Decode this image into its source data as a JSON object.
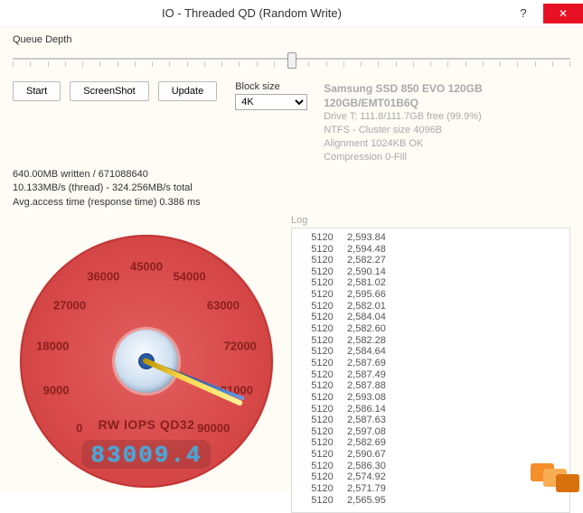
{
  "window": {
    "title": "IO - Threaded QD (Random Write)",
    "help_glyph": "?",
    "close_glyph": "✕"
  },
  "queue_depth": {
    "label": "Queue Depth"
  },
  "buttons": {
    "start": "Start",
    "screenshot": "ScreenShot",
    "update": "Update"
  },
  "block_size": {
    "label": "Block size",
    "value": "4K"
  },
  "drive": {
    "name": "Samsung SSD 850 EVO 120GB 120GB/EMT01B6Q",
    "line1": "Drive T: 111.8/111.7GB free (99.9%)",
    "line2": "NTFS - Cluster size 4096B",
    "line3": "Alignment 1024KB OK",
    "line4": "Compression 0-Fill"
  },
  "stats": {
    "line1": "640.00MB written / 671088640",
    "line2": "10.133MB/s (thread) - 324.256MB/s total",
    "line3": "Avg.access time (response time) 0.386 ms"
  },
  "log": {
    "label": "Log",
    "rows": [
      [
        5120,
        "2,593.84"
      ],
      [
        5120,
        "2,594.48"
      ],
      [
        5120,
        "2,582.27"
      ],
      [
        5120,
        "2,590.14"
      ],
      [
        5120,
        "2,581.02"
      ],
      [
        5120,
        "2,595.66"
      ],
      [
        5120,
        "2,582.01"
      ],
      [
        5120,
        "2,584.04"
      ],
      [
        5120,
        "2,582.60"
      ],
      [
        5120,
        "2,582.28"
      ],
      [
        5120,
        "2,584.64"
      ],
      [
        5120,
        "2,587.69"
      ],
      [
        5120,
        "2,587.49"
      ],
      [
        5120,
        "2,587.88"
      ],
      [
        5120,
        "2,593.08"
      ],
      [
        5120,
        "2,586.14"
      ],
      [
        5120,
        "2,587.63"
      ],
      [
        5120,
        "2,597.08"
      ],
      [
        5120,
        "2,582.69"
      ],
      [
        5120,
        "2,590.67"
      ],
      [
        5120,
        "2,586.30"
      ],
      [
        5120,
        "2,574.92"
      ],
      [
        5120,
        "2,571.79"
      ],
      [
        5120,
        "2,565.95"
      ]
    ]
  },
  "gauge": {
    "title": "RW IOPS QD32",
    "readout": "83009.4",
    "ticks": [
      "0",
      "9000",
      "18000",
      "27000",
      "36000",
      "45000",
      "54000",
      "63000",
      "72000",
      "81000",
      "90000"
    ],
    "min": 0,
    "max": 90000,
    "needle_value": 83009.4,
    "start_deg": 135,
    "end_deg": 405
  },
  "chart_data": {
    "type": "table",
    "title": "IO - Threaded QD (Random Write) Log",
    "columns": [
      "block_size_bytes",
      "value"
    ],
    "rows": [
      [
        5120,
        2593.84
      ],
      [
        5120,
        2594.48
      ],
      [
        5120,
        2582.27
      ],
      [
        5120,
        2590.14
      ],
      [
        5120,
        2581.02
      ],
      [
        5120,
        2595.66
      ],
      [
        5120,
        2582.01
      ],
      [
        5120,
        2584.04
      ],
      [
        5120,
        2582.6
      ],
      [
        5120,
        2582.28
      ],
      [
        5120,
        2584.64
      ],
      [
        5120,
        2587.69
      ],
      [
        5120,
        2587.49
      ],
      [
        5120,
        2587.88
      ],
      [
        5120,
        2593.08
      ],
      [
        5120,
        2586.14
      ],
      [
        5120,
        2587.63
      ],
      [
        5120,
        2597.08
      ],
      [
        5120,
        2582.69
      ],
      [
        5120,
        2590.67
      ],
      [
        5120,
        2586.3
      ],
      [
        5120,
        2574.92
      ],
      [
        5120,
        2571.79
      ],
      [
        5120,
        2565.95
      ]
    ],
    "gauge": {
      "label": "RW IOPS QD32",
      "value": 83009.4,
      "range": [
        0,
        90000
      ]
    }
  }
}
